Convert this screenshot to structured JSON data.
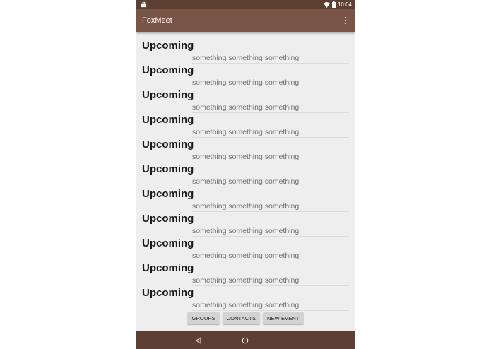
{
  "status_bar": {
    "time": "10:04"
  },
  "app_bar": {
    "title": "FoxMeet"
  },
  "events": [
    {
      "title": "Upcoming",
      "subtitle": "something something something"
    },
    {
      "title": "Upcoming",
      "subtitle": "something something something"
    },
    {
      "title": "Upcoming",
      "subtitle": "something something something"
    },
    {
      "title": "Upcoming",
      "subtitle": "something something something"
    },
    {
      "title": "Upcoming",
      "subtitle": "something something something"
    },
    {
      "title": "Upcoming",
      "subtitle": "something something something"
    },
    {
      "title": "Upcoming",
      "subtitle": "something something something"
    },
    {
      "title": "Upcoming",
      "subtitle": "something something something"
    },
    {
      "title": "Upcoming",
      "subtitle": "something something something"
    },
    {
      "title": "Upcoming",
      "subtitle": "something something something"
    },
    {
      "title": "Upcoming",
      "subtitle": "something something something"
    }
  ],
  "buttons": {
    "groups": "GROUPS",
    "contacts": "CONTACTS",
    "new_event": "NEW EVENT"
  },
  "colors": {
    "status_bar": "#5d3f33",
    "app_bar": "#795548",
    "nav_bar": "#5d3f33",
    "background": "#eeeeee"
  },
  "icons": [
    "briefcase-icon",
    "wifi-icon",
    "battery-icon",
    "overflow-menu-icon",
    "back-icon",
    "home-icon",
    "recents-icon"
  ]
}
